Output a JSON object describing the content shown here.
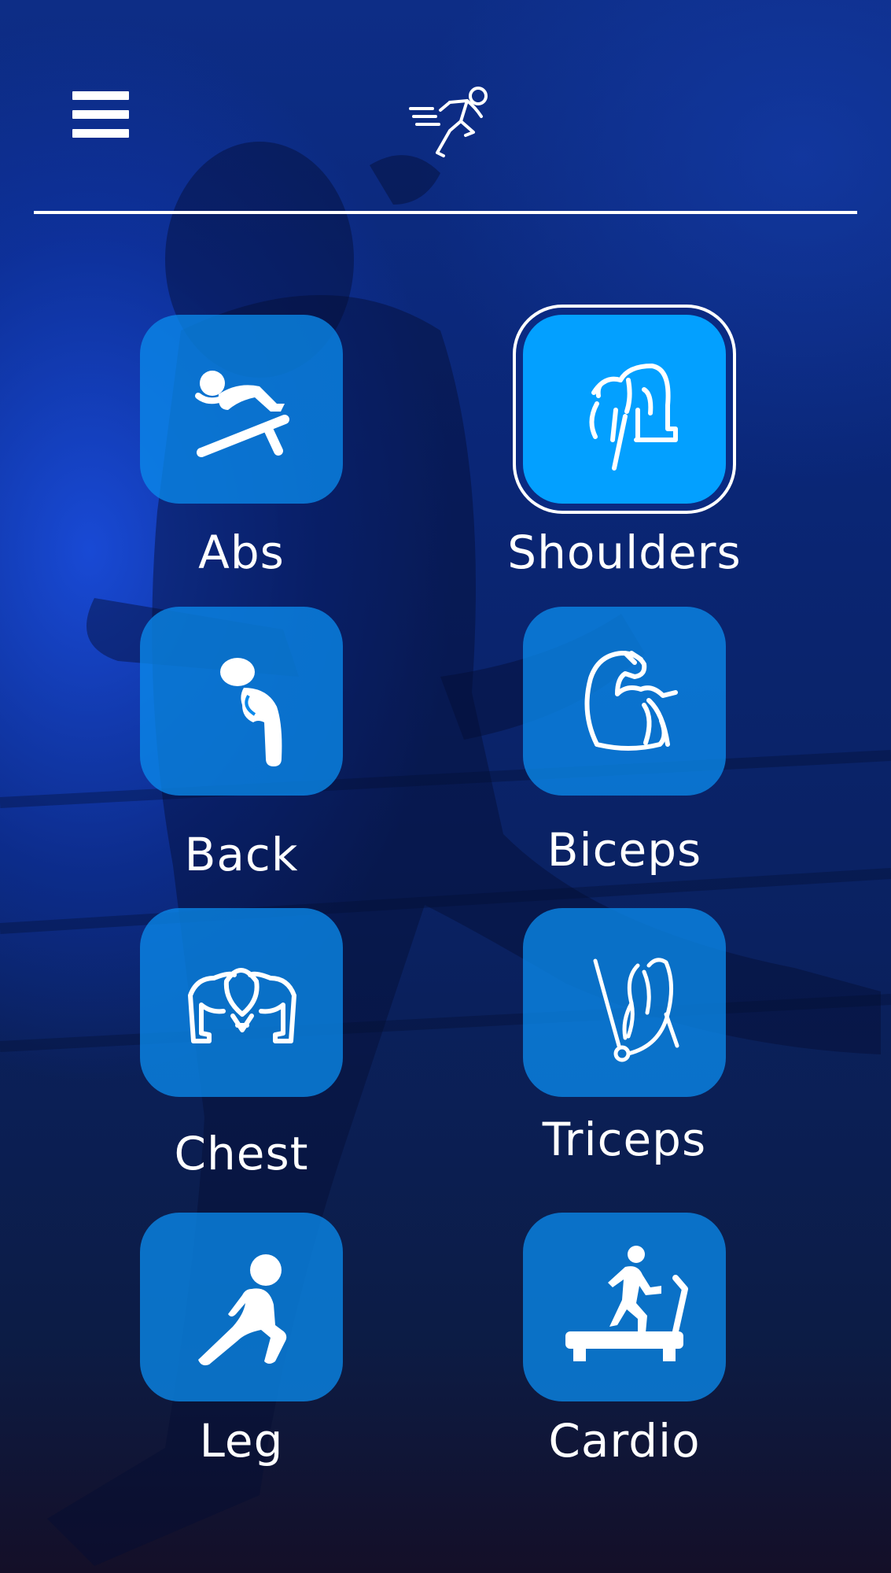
{
  "header": {
    "menu_icon": "hamburger-menu-icon",
    "logo_icon": "running-man-icon"
  },
  "colors": {
    "tile": "#0a89eb",
    "tile_selected": "#03a0ff",
    "background_top": "#0d2d86",
    "background_bottom": "#140f28"
  },
  "categories": [
    {
      "label": "Abs",
      "icon": "abs-situp-icon",
      "selected": false
    },
    {
      "label": "Shoulders",
      "icon": "shoulders-icon",
      "selected": true
    },
    {
      "label": "Back",
      "icon": "back-icon",
      "selected": false
    },
    {
      "label": "Biceps",
      "icon": "biceps-icon",
      "selected": false
    },
    {
      "label": "Chest",
      "icon": "chest-icon",
      "selected": false
    },
    {
      "label": "Triceps",
      "icon": "triceps-icon",
      "selected": false
    },
    {
      "label": "Leg",
      "icon": "leg-lunge-icon",
      "selected": false
    },
    {
      "label": "Cardio",
      "icon": "treadmill-icon",
      "selected": false
    }
  ]
}
